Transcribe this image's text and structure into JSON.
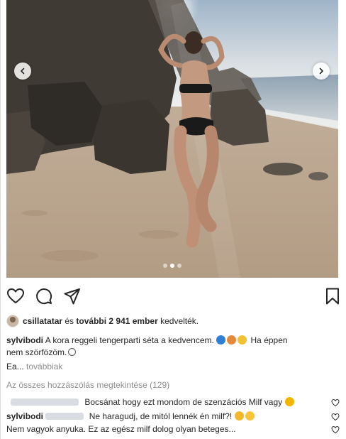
{
  "colors": {
    "text": "#262626",
    "muted": "#8e8e8e",
    "border": "#dbdbdb"
  },
  "media": {
    "image_description": "woman in black bikini on sandy beach beside rocks, sea in background",
    "carousel_dots": 3,
    "active_dot": 2,
    "prev_icon": "chevron-left-icon",
    "next_icon": "chevron-right-icon"
  },
  "actions": {
    "like_icon": "heart-icon",
    "comment_icon": "comment-icon",
    "share_icon": "paper-plane-icon",
    "save_icon": "bookmark-icon"
  },
  "likes": {
    "user": "csillatatar",
    "connector": " és ",
    "others": "további 2 941 ember",
    "suffix": " kedvelték."
  },
  "caption": {
    "username": "sylvibodi",
    "text_part1": "A kora reggeli tengerparti séta a kedvencem.",
    "text_part2": "Ha éppen",
    "text_line2": "nem szörfözöm.",
    "text_line3": "Ea...",
    "more_label": "továbbiak"
  },
  "view_all_comments": "Az összes hozzászólás megtekintése (129)",
  "comments": [
    {
      "username": "",
      "text": "Bocsánat hogy ezt mondom de szenzációs Milf vagy"
    },
    {
      "username": "sylvibodi",
      "text": "Ne haragudj, de mitól lennék én milf?!"
    },
    {
      "username": "",
      "text": "Nem vagyok anyuka. Ez az egész milf dolog olyan beteges..."
    }
  ]
}
